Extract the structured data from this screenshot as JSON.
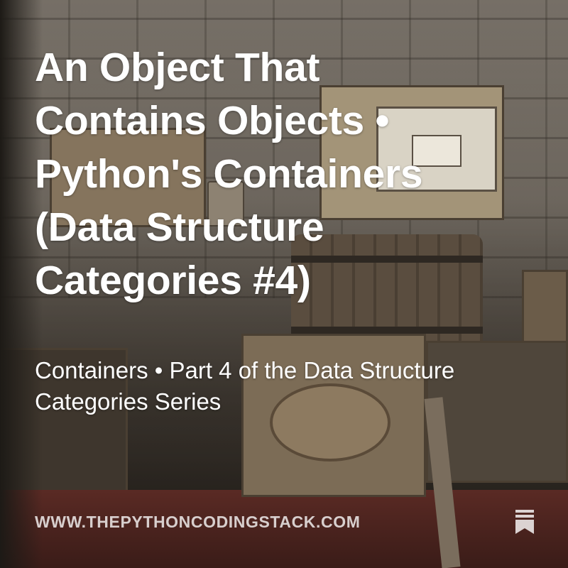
{
  "post": {
    "title": "An Object That Contains Objects • Python's Containers (Data Structure Categories #4)",
    "subtitle": "Containers • Part 4 of the Data Structure Categories Series",
    "site_url": "WWW.THEPYTHONCODINGSTACK.COM"
  },
  "icons": {
    "bookmark": "bookmark-icon"
  },
  "colors": {
    "text": "#ffffff",
    "url_text": "#ffffffc7"
  }
}
